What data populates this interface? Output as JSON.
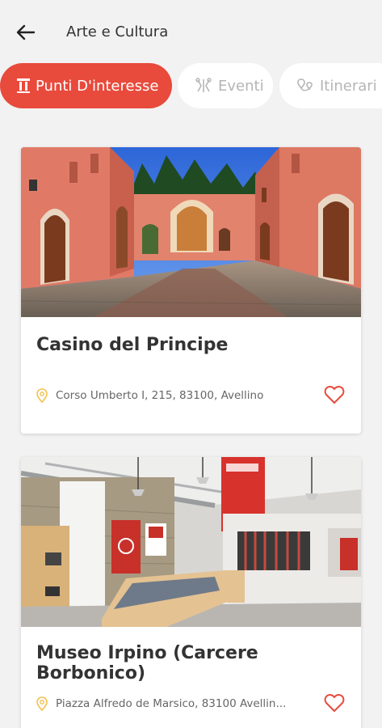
{
  "header": {
    "title": "Arte e Cultura",
    "back_icon": "arrow-left-icon"
  },
  "filters": [
    {
      "label": "Punti D'interesse",
      "icon": "column-icon",
      "active": true
    },
    {
      "label": "Eventi",
      "icon": "balloons-icon",
      "active": false
    },
    {
      "label": "Itinerari",
      "icon": "route-icon",
      "active": false
    }
  ],
  "cards": [
    {
      "title": "Casino del Principe",
      "address": "Corso Umberto I, 215, 83100, Avellino",
      "image": "courtyard-photo",
      "favorite_icon": "heart-outline-icon"
    },
    {
      "title": "Museo Irpino (Carcere Borbonico)",
      "address": "Piazza Alfredo de Marsico, 83100 Avellin...",
      "image": "museum-interior-photo",
      "favorite_icon": "heart-outline-icon"
    }
  ],
  "colors": {
    "accent": "#e84a3c",
    "pin": "#f2c14e",
    "background": "#f2f2f2"
  }
}
